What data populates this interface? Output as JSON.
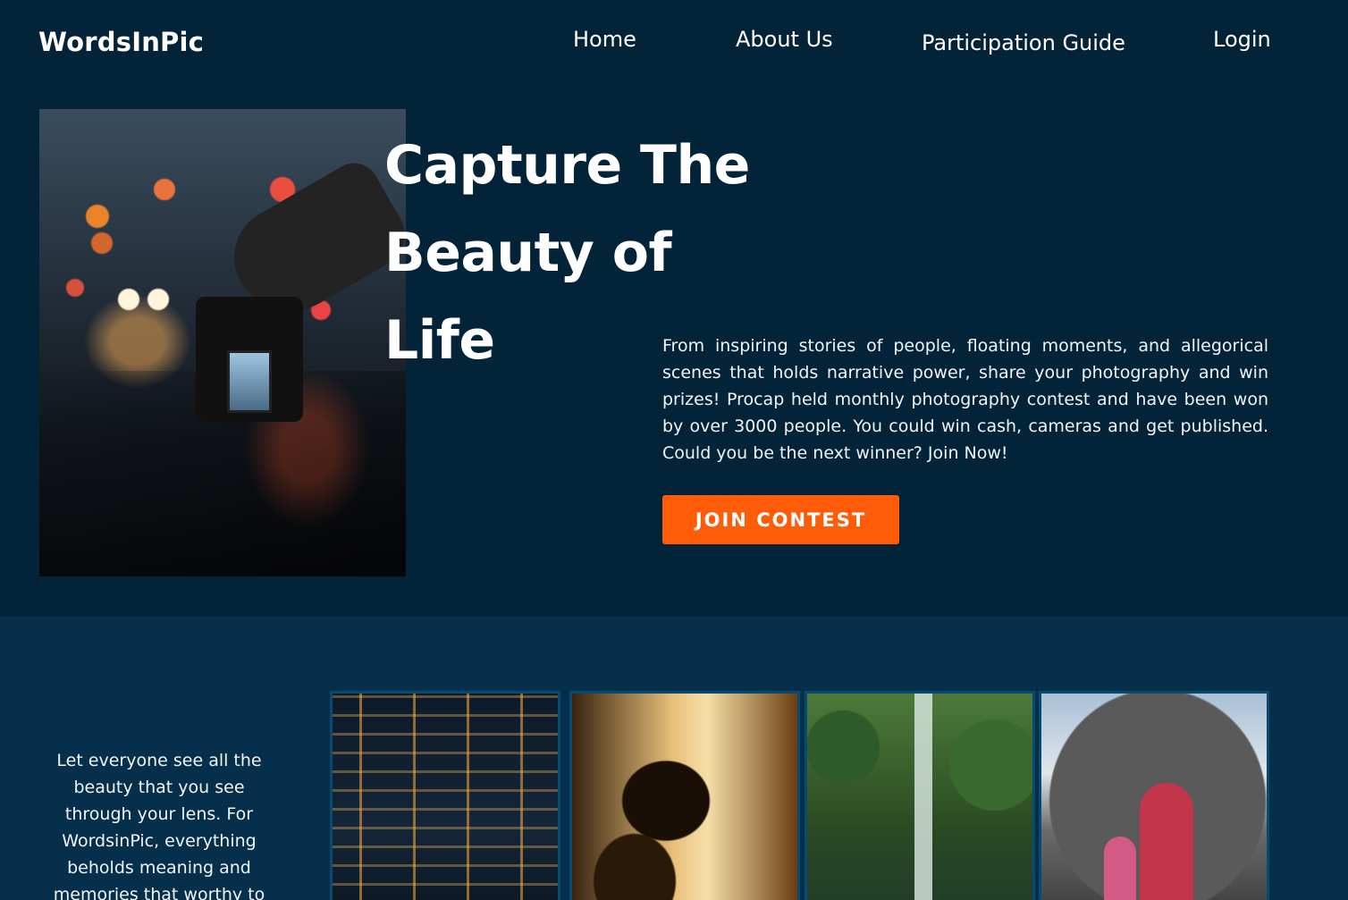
{
  "header": {
    "brand": "WordsInPic",
    "nav": {
      "home": "Home",
      "about": "About Us",
      "guide": "Participation Guide",
      "login": "Login"
    }
  },
  "hero": {
    "title": "Capture The Beauty of Life",
    "description": "From inspiring stories of people, floating moments, and allegorical scenes that holds narrative power, share your photography and win prizes! Procap held monthly photography contest and have been won by over 3000 people. You could win cash, cameras and get published. Could you be the next winner? Join Now!",
    "button_label": "JOIN CONTEST"
  },
  "gallery": {
    "text": "Let everyone see all the beauty that you see through your lens. For WordsinPic, everything beholds meaning and memories that worthy to"
  },
  "colors": {
    "hero_bg": "#032339",
    "section_bg": "#052f4a",
    "accent": "#ff5c0a"
  }
}
